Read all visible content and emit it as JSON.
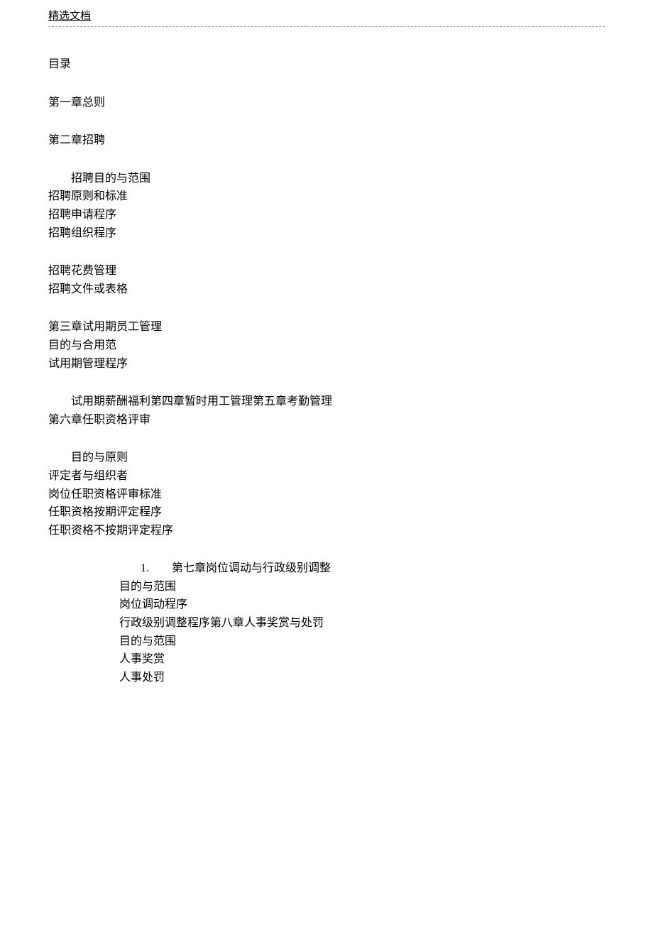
{
  "header": {
    "link_text": "精选文档"
  },
  "toc_title": "目录",
  "chapter1_title": "第一章总则",
  "chapter2_title": "第二章招聘",
  "chapter2": {
    "item1": "招聘目的与范围",
    "item2": "招聘原则和标准",
    "item3": "招聘申请程序",
    "item4": "招聘组织程序",
    "item5": "招聘花费管理",
    "item6": "招聘文件或表格"
  },
  "chapter3": {
    "title": "第三章试用期员工管理",
    "item1": "目的与合用范",
    "item2": "试用期管理程序",
    "combined_line": "试用期薪酬福利第四章暂时用工管理第五章考勤管理",
    "chapter6_title": "第六章任职资格评审"
  },
  "chapter6": {
    "item1": "目的与原则",
    "item2": "评定者与组织者",
    "item3": "岗位任职资格评审标准",
    "item4": "任职资格按期评定程序",
    "item5": "任职资格不按期评定程序"
  },
  "list_section": {
    "number": "1.",
    "chapter7_title": "第七章岗位调动与行政级别调整",
    "item1": "目的与范围",
    "item2": "岗位调动程序",
    "item3": "行政级别调整程序第八章人事奖赏与处罚",
    "item4": "目的与范围",
    "item5": "人事奖赏",
    "item6": "人事处罚"
  }
}
